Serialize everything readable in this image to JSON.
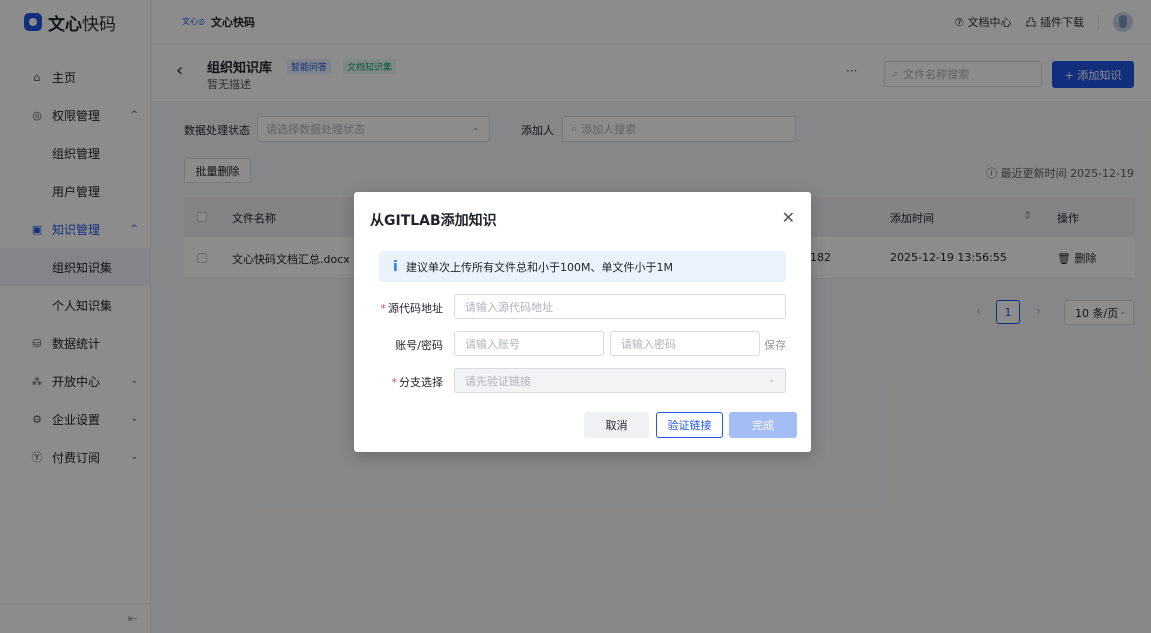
{
  "sidebar": {
    "logo_bold": "文心",
    "logo_light": "快码",
    "items": [
      {
        "label": "主页",
        "icon": "home-icon"
      },
      {
        "label": "权限管理",
        "icon": "shield-icon"
      },
      {
        "label": "组织管理"
      },
      {
        "label": "用户管理"
      },
      {
        "label": "知识管理",
        "icon": "book-icon"
      },
      {
        "label": "组织知识集"
      },
      {
        "label": "个人知识集"
      },
      {
        "label": "数据统计",
        "icon": "database-icon"
      },
      {
        "label": "开放中心",
        "icon": "nodes-icon"
      },
      {
        "label": "企业设置",
        "icon": "settings-icon"
      },
      {
        "label": "付费订阅",
        "icon": "coin-icon"
      }
    ]
  },
  "topbar": {
    "brand_small": "文心◎",
    "app_name": "文心快码",
    "doc_center": "⑦ 文档中心",
    "plugin_download": "凸 插件下载"
  },
  "page": {
    "title": "组织知识库",
    "description": "暂无描述",
    "tag_qa": "智能问答",
    "tag_doc": "文档知识集",
    "more": "···",
    "search_placeholder": "文件名称搜索",
    "add_button": "+ 添加知识"
  },
  "filters": {
    "status_label": "数据处理状态",
    "status_placeholder": "请选择数据处理状态",
    "adder_label": "添加人",
    "adder_placeholder": "添加人搜索",
    "batch_delete": "批量删除",
    "update_time": "ⓘ 最近更新时间 2025-12-19"
  },
  "table": {
    "headers": {
      "file_name": "文件名称",
      "added_time": "添加时间",
      "actions": "操作"
    },
    "rows": [
      {
        "file_name": "文心快码文档汇总.docx",
        "partial": "182",
        "added_time": "2025-12-19 13:56:55",
        "action": "删除"
      }
    ]
  },
  "pagination": {
    "current": "1",
    "page_size": "10 条/页"
  },
  "modal": {
    "title": "从GITLAB添加知识",
    "info": "建议单次上传所有文件总和小于100M、单文件小于1M",
    "source_label": "源代码地址",
    "source_placeholder": "请输入源代码地址",
    "account_label": "账号/密码",
    "account_placeholder": "请输入账号",
    "password_placeholder": "请输入密码",
    "save_label": "保存",
    "branch_label": "分支选择",
    "branch_placeholder": "请先验证链接",
    "cancel": "取消",
    "verify": "验证链接",
    "done": "完成"
  },
  "colors": {
    "accent": "#2156e6",
    "required": "#e34d59",
    "info_bg": "#eaf3fc"
  }
}
